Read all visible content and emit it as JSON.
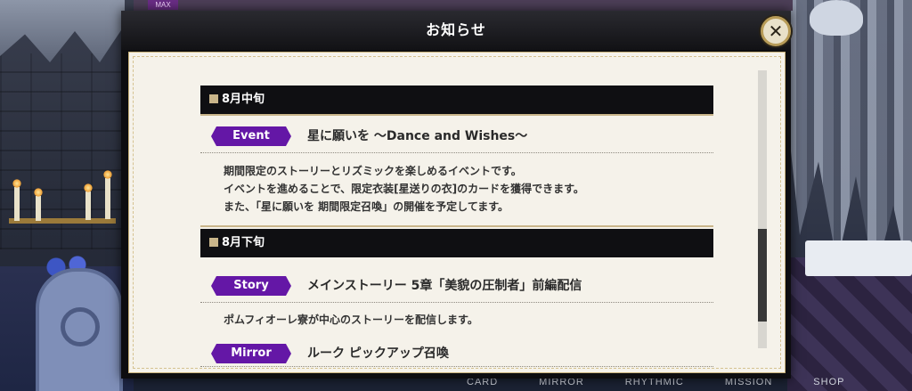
{
  "background": {
    "max_tag": "MAX",
    "bottom_menu": [
      "CARD",
      "MIRROR",
      "RHYTHMIC",
      "MISSION",
      "SHOP"
    ]
  },
  "modal": {
    "title": "お知らせ",
    "close_icon": "close-icon",
    "sections": [
      {
        "heading": "8月中旬",
        "entries": [
          {
            "tag": "Event",
            "title": "星に願いを 〜Dance and Wishes〜",
            "lines": [
              "期間限定のストーリーとリズミックを楽しめるイベントです。",
              "イベントを進めることで、限定衣装[星送りの衣]のカードを獲得できます。",
              "また、「星に願いを 期間限定召喚」の開催を予定してます。"
            ]
          }
        ]
      },
      {
        "heading": "8月下旬",
        "entries": [
          {
            "tag": "Story",
            "title": "メインストーリー 5章「美貌の圧制者」前編配信",
            "lines": [
              "ポムフィオーレ寮が中心のストーリーを配信します。"
            ]
          },
          {
            "tag": "Mirror",
            "title": "ルーク ピックアップ召喚",
            "lines": []
          }
        ]
      }
    ]
  },
  "colors": {
    "tag_bg": "#6417a6",
    "section_bg": "#0f0f12",
    "paper": "#f5f2ea",
    "gold": "#c9b58a"
  }
}
